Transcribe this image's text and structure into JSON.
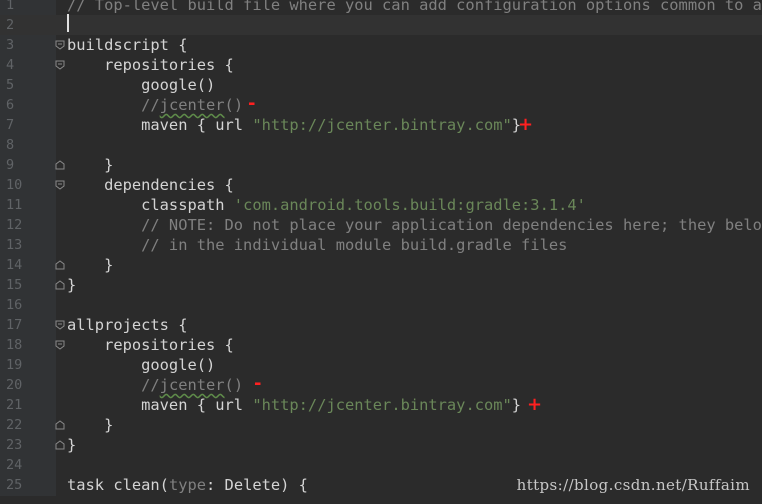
{
  "editor": {
    "lines": [
      {
        "num": "1",
        "segments": [
          {
            "t": "// Top-level build file where you can add configuration options common to all",
            "c": "comment"
          }
        ]
      },
      {
        "num": "2",
        "segments": []
      },
      {
        "num": "3",
        "segments": [
          {
            "t": "buildscript {",
            "c": "plain"
          }
        ]
      },
      {
        "num": "4",
        "segments": [
          {
            "t": "    repositories {",
            "c": "plain"
          }
        ]
      },
      {
        "num": "5",
        "segments": [
          {
            "t": "        google()",
            "c": "plain"
          }
        ]
      },
      {
        "num": "6",
        "segments": [
          {
            "t": "        //",
            "c": "comment"
          },
          {
            "t": "jcenter",
            "c": "comment underlined"
          },
          {
            "t": "()",
            "c": "comment"
          }
        ]
      },
      {
        "num": "7",
        "segments": [
          {
            "t": "        maven { url ",
            "c": "plain"
          },
          {
            "t": "\"http://jcenter.bintray.com\"",
            "c": "string"
          },
          {
            "t": "}",
            "c": "plain"
          }
        ]
      },
      {
        "num": "8",
        "segments": []
      },
      {
        "num": "9",
        "segments": [
          {
            "t": "    }",
            "c": "plain"
          }
        ]
      },
      {
        "num": "10",
        "segments": [
          {
            "t": "    dependencies {",
            "c": "plain"
          }
        ]
      },
      {
        "num": "11",
        "segments": [
          {
            "t": "        classpath ",
            "c": "plain"
          },
          {
            "t": "'com.android.tools.build:gradle:3.1.4'",
            "c": "string"
          }
        ]
      },
      {
        "num": "12",
        "segments": [
          {
            "t": "        // NOTE: Do not place your application dependencies here; they belong",
            "c": "comment"
          }
        ]
      },
      {
        "num": "13",
        "segments": [
          {
            "t": "        // in the individual module build.gradle files",
            "c": "comment"
          }
        ]
      },
      {
        "num": "14",
        "segments": [
          {
            "t": "    }",
            "c": "plain"
          }
        ]
      },
      {
        "num": "15",
        "segments": [
          {
            "t": "}",
            "c": "plain"
          }
        ]
      },
      {
        "num": "16",
        "segments": []
      },
      {
        "num": "17",
        "segments": [
          {
            "t": "allprojects {",
            "c": "plain"
          }
        ]
      },
      {
        "num": "18",
        "segments": [
          {
            "t": "    repositories {",
            "c": "plain"
          }
        ]
      },
      {
        "num": "19",
        "segments": [
          {
            "t": "        google()",
            "c": "plain"
          }
        ]
      },
      {
        "num": "20",
        "segments": [
          {
            "t": "        //",
            "c": "comment"
          },
          {
            "t": "jcenter",
            "c": "comment underlined"
          },
          {
            "t": "()",
            "c": "comment"
          }
        ]
      },
      {
        "num": "21",
        "segments": [
          {
            "t": "        maven { url ",
            "c": "plain"
          },
          {
            "t": "\"http://jcenter.bintray.com\"",
            "c": "string"
          },
          {
            "t": "}",
            "c": "plain"
          }
        ]
      },
      {
        "num": "22",
        "segments": [
          {
            "t": "    }",
            "c": "plain"
          }
        ]
      },
      {
        "num": "23",
        "segments": [
          {
            "t": "}",
            "c": "plain"
          }
        ]
      },
      {
        "num": "24",
        "segments": []
      },
      {
        "num": "25",
        "segments": [
          {
            "t": "task clean(",
            "c": "plain"
          },
          {
            "t": "type",
            "c": "comment"
          },
          {
            "t": ": Delete) {",
            "c": "plain"
          }
        ]
      }
    ],
    "annotations": {
      "minus_line6": "-",
      "plus_line7": "+",
      "minus_line20": "-",
      "plus_line21": "+"
    },
    "colors": {
      "background": "#2b2b2b",
      "comment": "#808080",
      "string": "#6a8759",
      "annotation_red": "#ff2020"
    }
  },
  "watermark": "https://blog.csdn.net/Ruffaim"
}
